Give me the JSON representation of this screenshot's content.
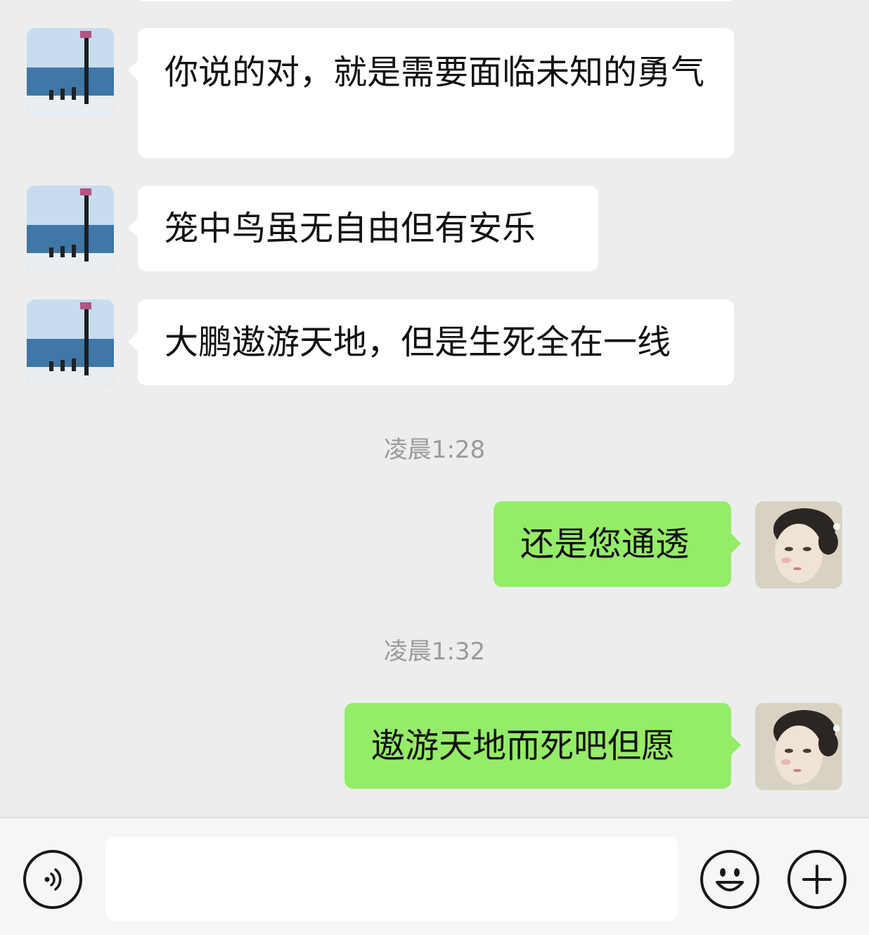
{
  "messages": [
    {
      "side": "in",
      "text": "你说的对，就是需要面临未知的勇气"
    },
    {
      "side": "in",
      "text": "笼中鸟虽无自由但有安乐"
    },
    {
      "side": "in",
      "text": "大鹏遨游天地，但是生死全在一线"
    },
    {
      "timestamp": "凌晨1:28"
    },
    {
      "side": "out",
      "text": "还是您通透"
    },
    {
      "timestamp": "凌晨1:32"
    },
    {
      "side": "out",
      "text": "遨游天地而死吧但愿"
    }
  ],
  "input": {
    "value": "",
    "placeholder": ""
  },
  "icons": {
    "voice": "voice-icon",
    "emoji": "emoji-icon",
    "plus": "plus-icon",
    "contact_avatar": "seascape-avatar",
    "my_avatar": "portrait-avatar"
  },
  "colors": {
    "background": "#ededed",
    "incoming_bubble": "#ffffff",
    "outgoing_bubble": "#95ec69",
    "timestamp": "#9a9a9a"
  }
}
